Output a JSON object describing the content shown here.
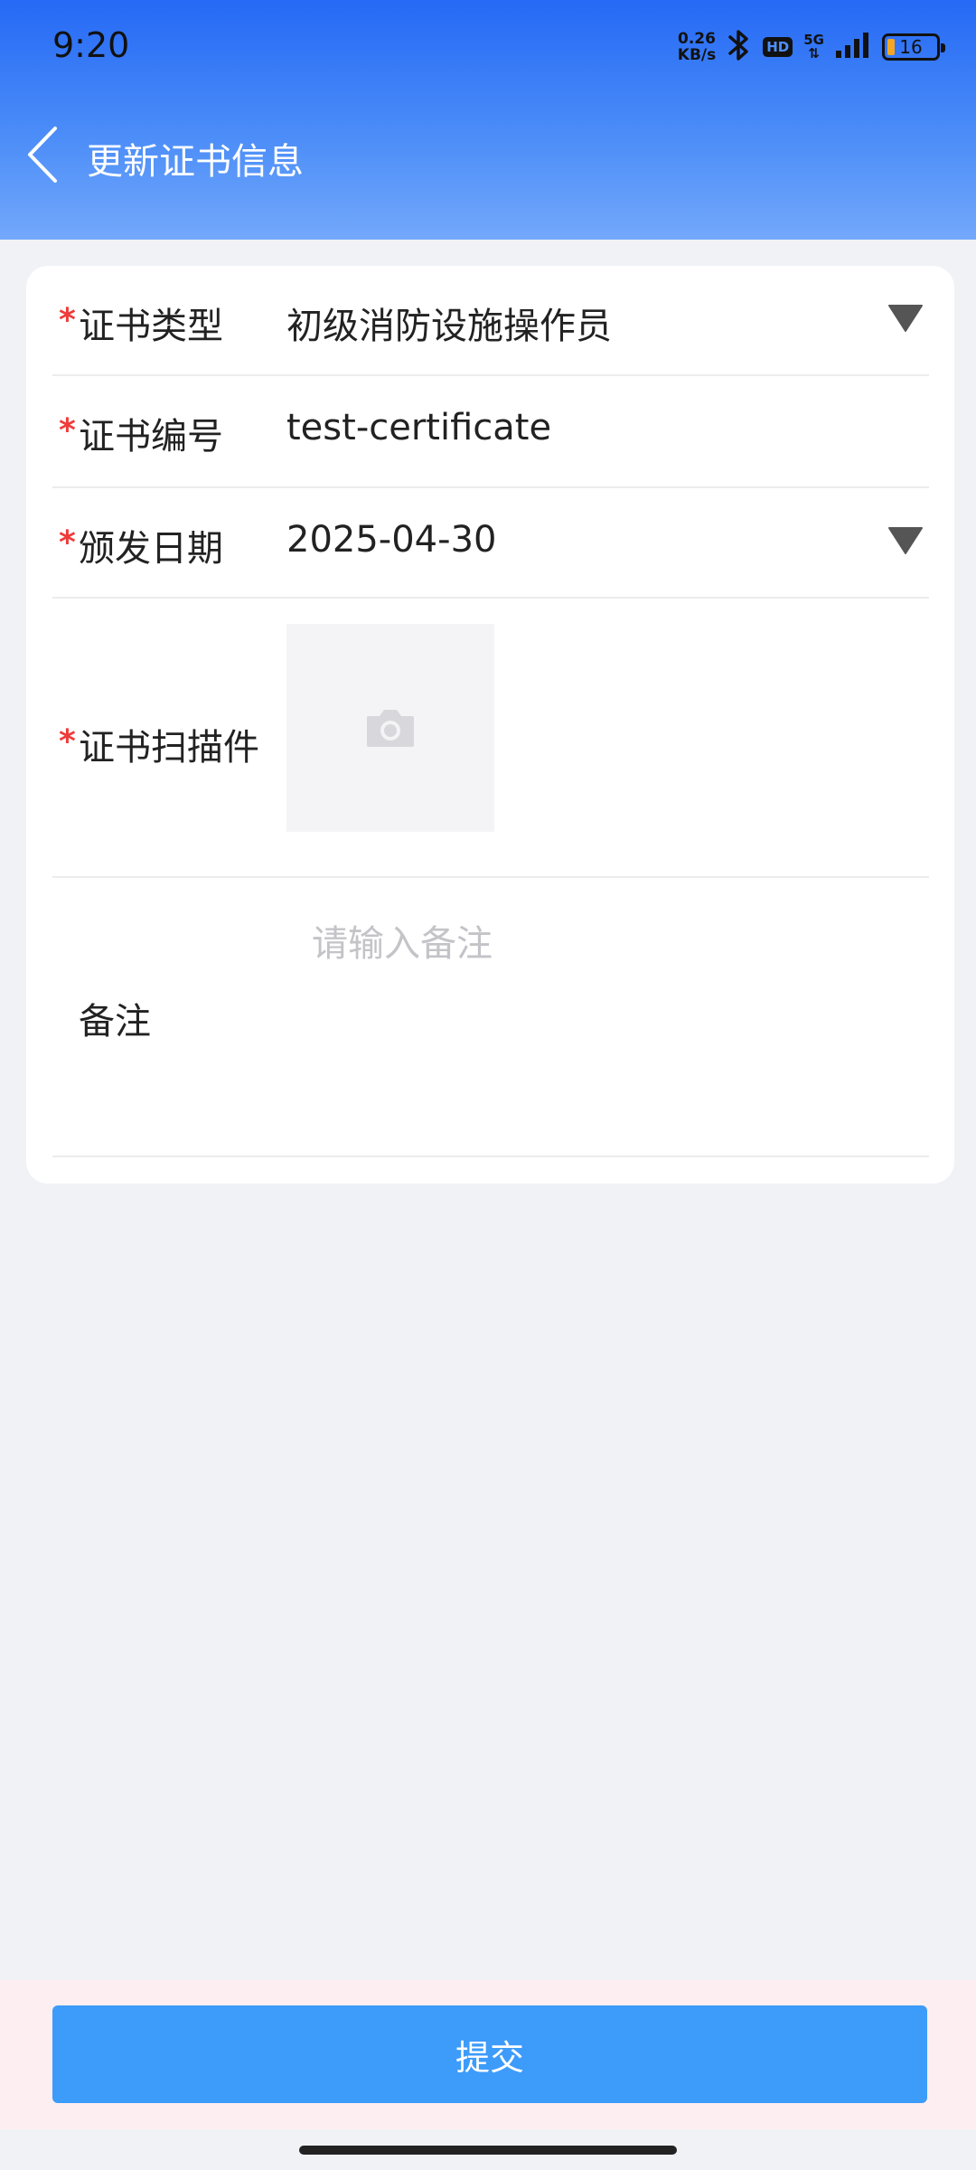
{
  "status_bar": {
    "time": "9:20",
    "net_speed_value": "0.26",
    "net_speed_unit": "KB/s",
    "hd_label": "HD",
    "network_label": "5G",
    "battery_level": "16"
  },
  "nav": {
    "title": "更新证书信息"
  },
  "form": {
    "cert_type": {
      "label": "证书类型",
      "value": "初级消防设施操作员",
      "required_mark": "*"
    },
    "cert_number": {
      "label": "证书编号",
      "value": "test-certificate",
      "required_mark": "*"
    },
    "issue_date": {
      "label": "颁发日期",
      "value": "2025-04-30",
      "required_mark": "*"
    },
    "cert_scan": {
      "label": "证书扫描件",
      "required_mark": "*"
    },
    "remark": {
      "label": "备注",
      "placeholder": "请输入备注"
    }
  },
  "footer": {
    "submit_label": "提交"
  },
  "colors": {
    "header_top": "#2569f5",
    "header_bottom": "#73a8fb",
    "submit_button": "#3d9bfa",
    "required": "#ee3b3b"
  }
}
